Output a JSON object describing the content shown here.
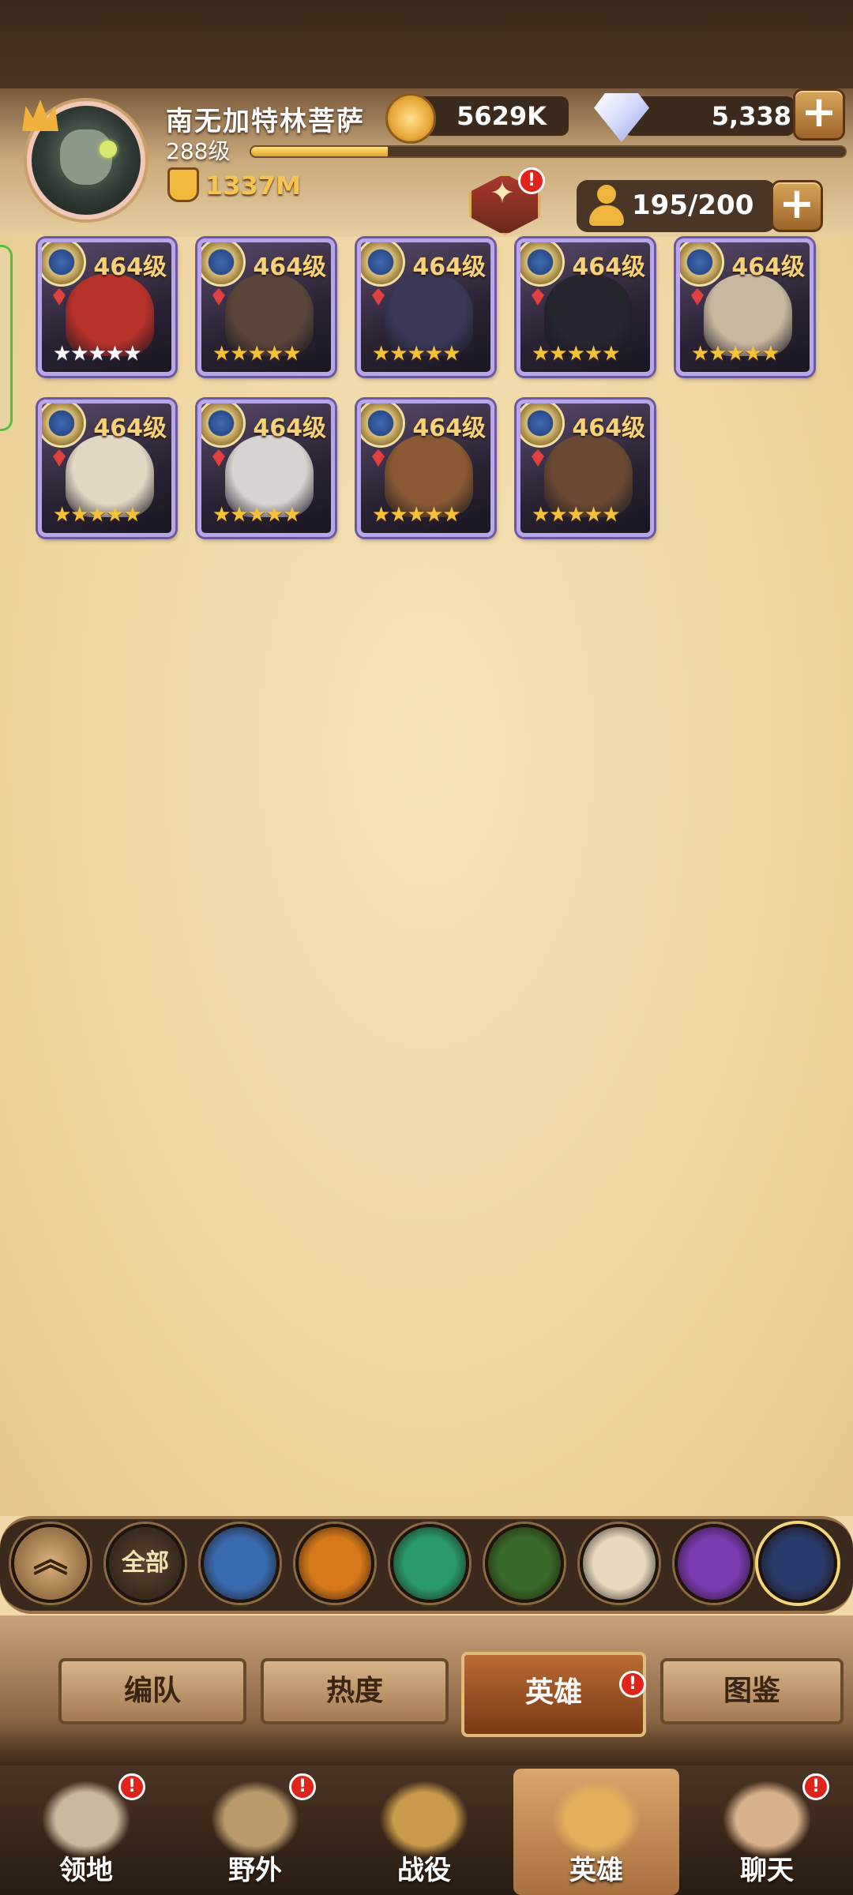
{
  "player": {
    "name": "南无加特林菩萨",
    "level": "288级",
    "xp_progress": 0.23,
    "power": "1337M"
  },
  "currency": {
    "gold": "5629K",
    "diamonds": "5,338"
  },
  "roster": {
    "count": "195/200"
  },
  "heroes": [
    {
      "level": "464级",
      "stars": "★★★★★",
      "star_color": "white",
      "portrait_color": "#b8322a"
    },
    {
      "level": "464级",
      "stars": "★★★★★",
      "star_color": "gold",
      "portrait_color": "#5a4638"
    },
    {
      "level": "464级",
      "stars": "★★★★★",
      "star_color": "gold",
      "portrait_color": "#3a3a58"
    },
    {
      "level": "464级",
      "stars": "★★★★★",
      "star_color": "gold",
      "portrait_color": "#262630"
    },
    {
      "level": "464级",
      "stars": "★★★★★",
      "star_color": "gold",
      "portrait_color": "#c9b8a0"
    },
    {
      "level": "464级",
      "stars": "★★★★★",
      "star_color": "gold",
      "portrait_color": "#e2d6c4"
    },
    {
      "level": "464级",
      "stars": "★★★★★",
      "star_color": "gold",
      "portrait_color": "#d8d2d0"
    },
    {
      "level": "464级",
      "stars": "★★★★★",
      "star_color": "gold",
      "portrait_color": "#8a5a32"
    },
    {
      "level": "464级",
      "stars": "★★★★★",
      "star_color": "gold",
      "portrait_color": "#6a4a34"
    }
  ],
  "faction_filter": {
    "collapse_icon": "double-chevron-up-icon",
    "all_label": "全部",
    "factions": [
      {
        "icon": "lightbearer-compass-icon",
        "color": "#3a6ab0"
      },
      {
        "icon": "mauler-shield-icon",
        "color": "#d87a1c"
      },
      {
        "icon": "wilder-leaf-icon",
        "color": "#2a9a6a"
      },
      {
        "icon": "graveborn-eye-icon",
        "color": "#3a6a2a"
      },
      {
        "icon": "celestial-star-icon",
        "color": "#e8d8c0"
      },
      {
        "icon": "hypogean-crystal-icon",
        "color": "#7a3ab0"
      },
      {
        "icon": "dimensional-orb-icon",
        "color": "#2a3a6a"
      }
    ]
  },
  "tabs": [
    "编队",
    "热度",
    "英雄",
    "图鉴"
  ],
  "nav": [
    "领地",
    "野外",
    "战役",
    "英雄",
    "聊天"
  ],
  "badge_mark": "!",
  "colors": {
    "badge": "#e0241c",
    "accent_gold": "#f6c451",
    "parchment": "#f0d9a6"
  }
}
